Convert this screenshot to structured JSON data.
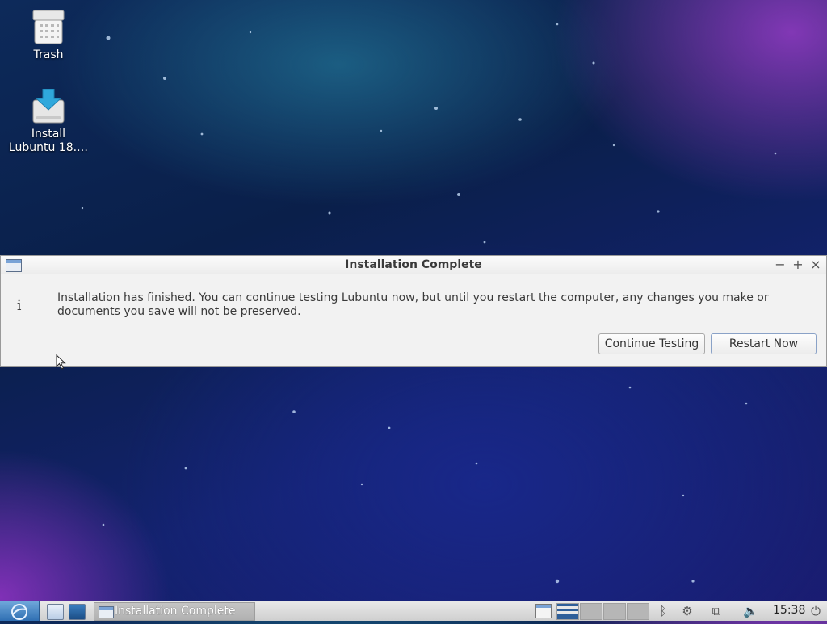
{
  "desktop": {
    "icons": [
      {
        "label": "Trash",
        "icon": "trash-icon"
      },
      {
        "label": "Install\nLubuntu 18.…",
        "line1": "Install",
        "line2": "Lubuntu 18.…",
        "icon": "install-icon"
      }
    ]
  },
  "dialog": {
    "title": "Installation Complete",
    "info_glyph": "i",
    "message": "Installation has finished.  You can continue testing Lubuntu now, but until you restart the computer, any changes you make or documents you save will not be preserved.",
    "buttons": {
      "continue": "Continue Testing",
      "restart": "Restart Now"
    },
    "controls": {
      "minimize": "−",
      "maximize": "+",
      "close": "×"
    }
  },
  "taskbar": {
    "task_label": "Installation Complete",
    "clock": "15:38",
    "workspaces": 4,
    "active_workspace": 1
  },
  "colors": {
    "dialog_bg": "#f2f2f2",
    "taskbar_bg": "#dcdcdc",
    "accent": "#2f6fb3"
  }
}
